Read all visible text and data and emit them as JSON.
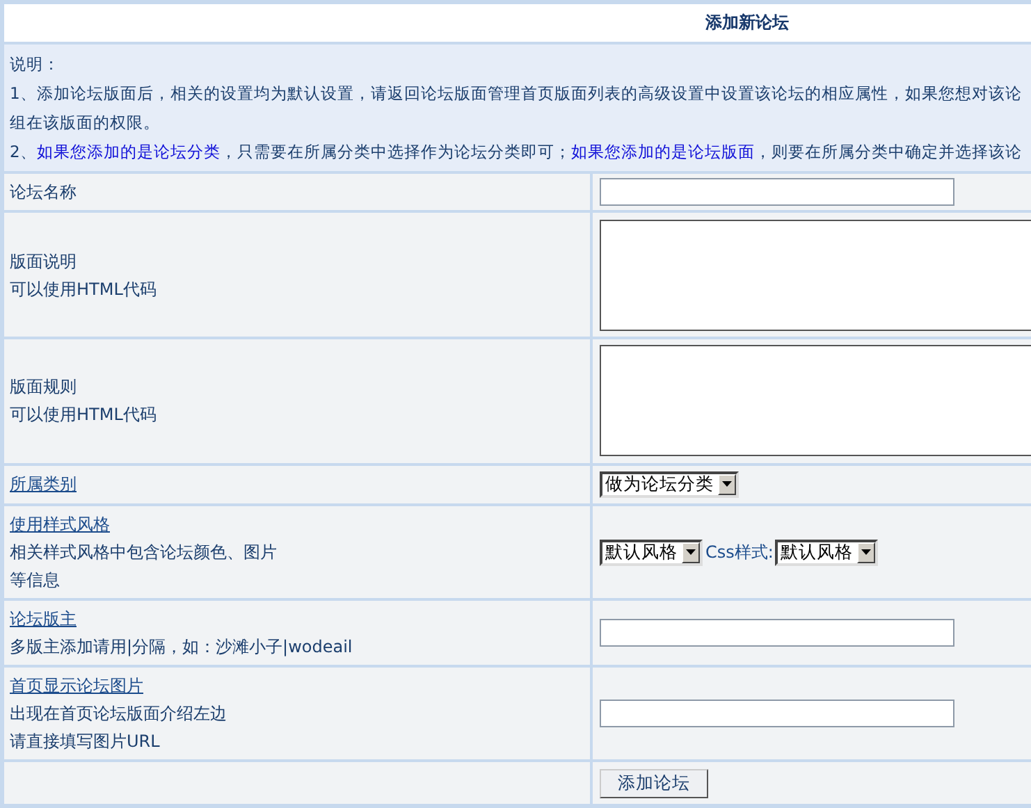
{
  "title": "添加新论坛",
  "notes": {
    "heading": "说明：",
    "items": [
      {
        "lines": [
          [
            {
              "kind": "plain",
              "text": "1、添加论坛版面后，相关的设置均为默认设置，请返回论坛版面管理首页版面列表的高级设置中设置该论坛的相应属性，如果您想对该论"
            }
          ],
          [
            {
              "kind": "plain",
              "text": "组在该版面的权限。"
            }
          ]
        ]
      },
      {
        "lines": [
          [
            {
              "kind": "plain",
              "text": "2、"
            },
            {
              "kind": "highlight",
              "text": "如果您添加的是论坛分类"
            },
            {
              "kind": "plain",
              "text": "，只需要在所属分类中选择作为论坛分类即可；"
            },
            {
              "kind": "highlight",
              "text": "如果您添加的是论坛版面"
            },
            {
              "kind": "plain",
              "text": "，则要在所属分类中确定并选择该论"
            }
          ]
        ]
      }
    ]
  },
  "rows": [
    {
      "kind": "text",
      "label": "论坛名称",
      "link": false,
      "hints": []
    },
    {
      "kind": "textarea",
      "label": "版面说明",
      "link": false,
      "hints": [
        "可以使用HTML代码"
      ]
    },
    {
      "kind": "textarea",
      "label": "版面规则",
      "link": false,
      "hints": [
        "可以使用HTML代码"
      ]
    },
    {
      "kind": "select",
      "label": "所属类别",
      "link": true,
      "hints": [],
      "value": "做为论坛分类"
    },
    {
      "kind": "style",
      "label": "使用样式风格",
      "link": true,
      "hints": [
        "相关样式风格中包含论坛颜色、图片",
        "等信息"
      ],
      "value": "默认风格",
      "css_label": "Css样式:",
      "css_value": "默认风格"
    },
    {
      "kind": "text",
      "label": "论坛版主",
      "link": true,
      "hints": [
        "多版主添加请用|分隔，如：沙滩小子|wodeail"
      ]
    },
    {
      "kind": "text",
      "label": "首页显示论坛图片",
      "link": true,
      "hints": [
        "出现在首页论坛版面介绍左边",
        "请直接填写图片URL"
      ]
    },
    {
      "kind": "submit",
      "label": "添加论坛"
    }
  ]
}
